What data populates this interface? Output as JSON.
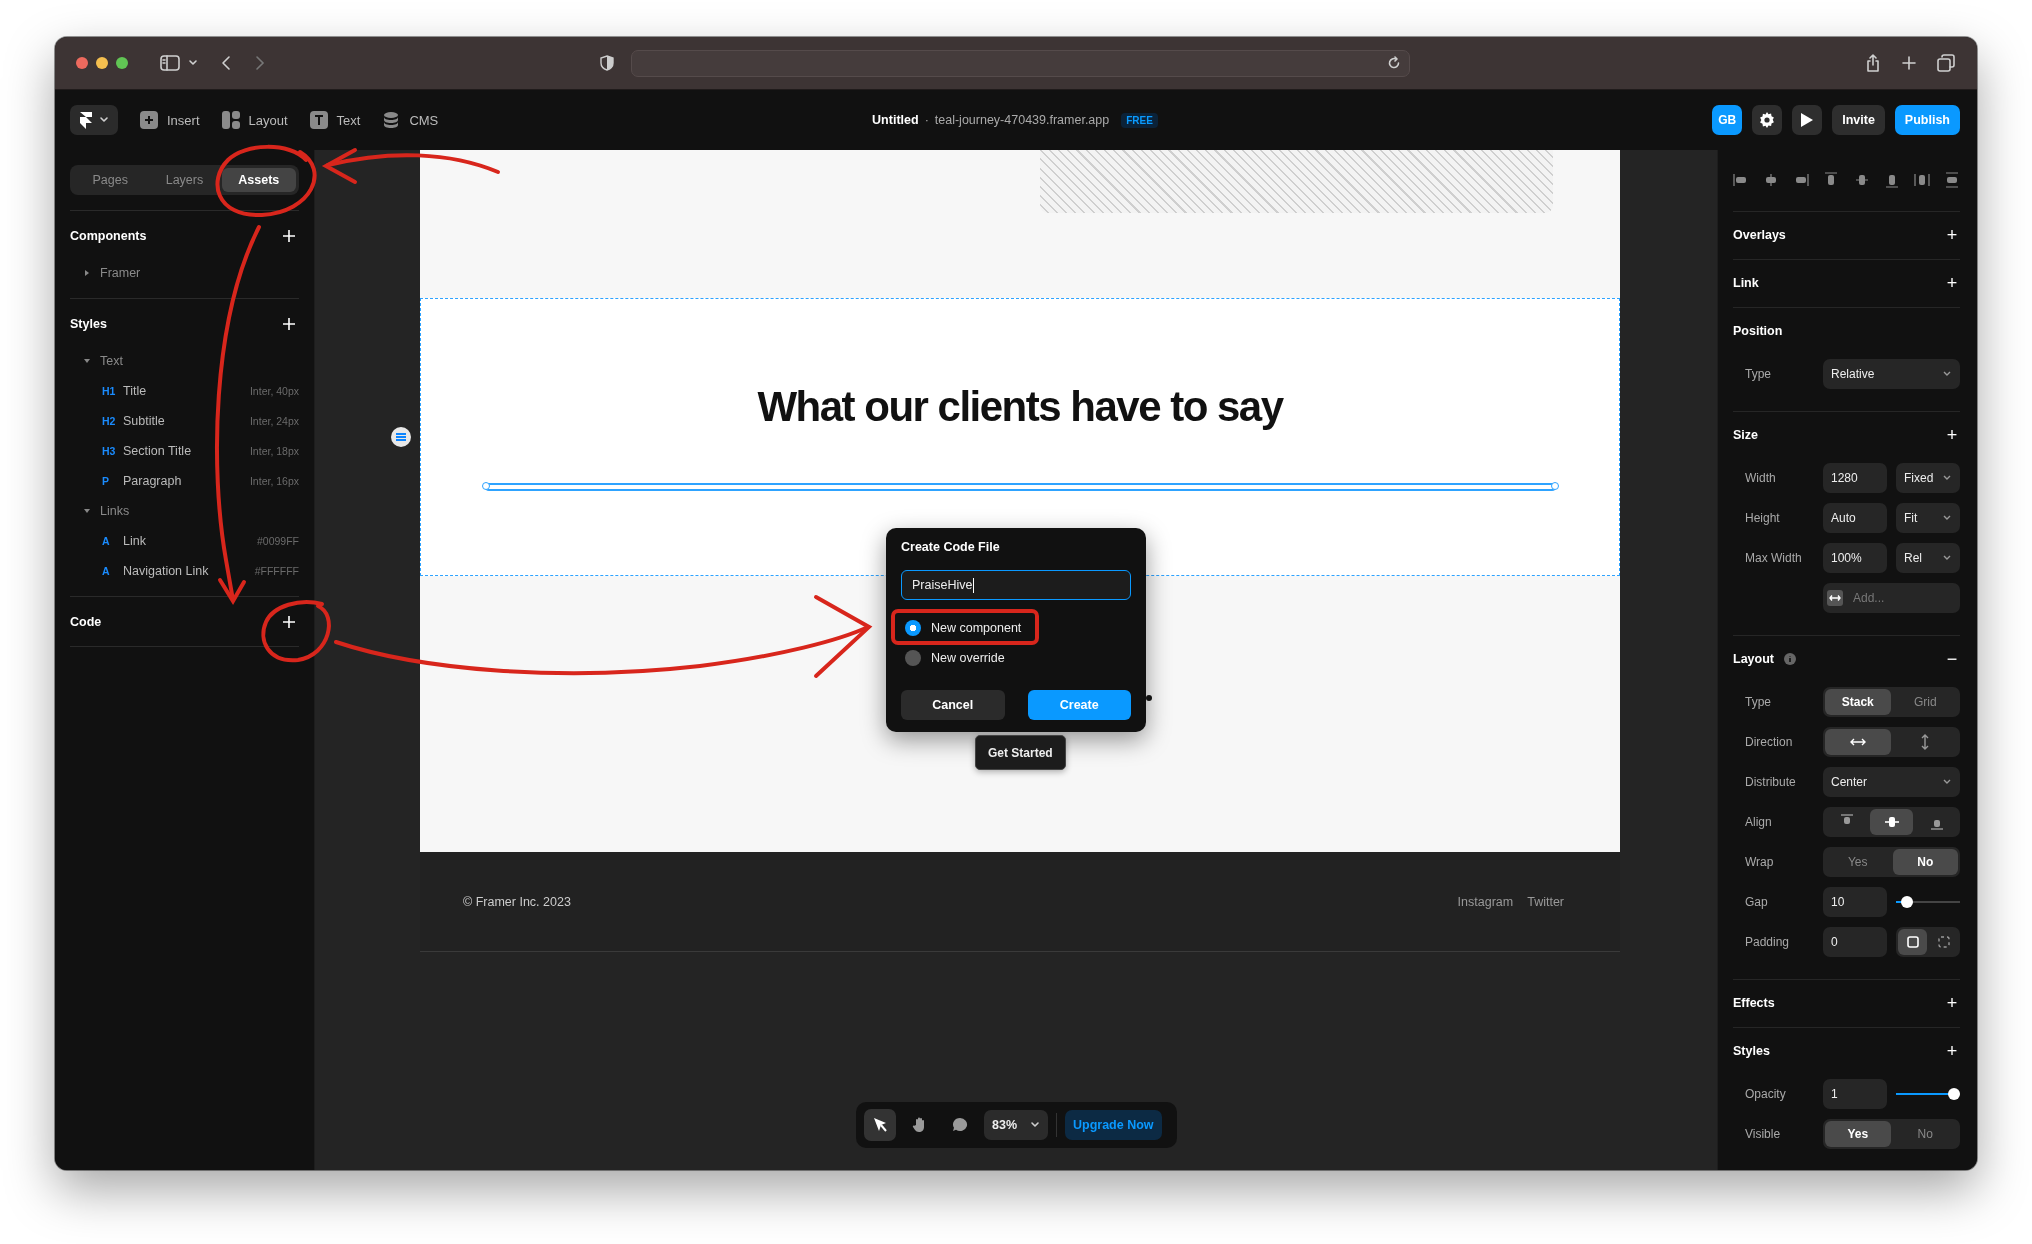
{
  "toolbar": {
    "menu": [
      {
        "kind": "insert",
        "label": "Insert"
      },
      {
        "kind": "layout",
        "label": "Layout"
      },
      {
        "kind": "text",
        "label": "Text"
      },
      {
        "kind": "cms",
        "label": "CMS"
      }
    ],
    "title": "Untitled",
    "separator": "·",
    "url": "teal-journey-470439.framer.app",
    "plan": "FREE",
    "avatar": "GB",
    "invite": "Invite",
    "publish": "Publish"
  },
  "left_panel": {
    "tabs": [
      {
        "label": "Pages",
        "selected": false
      },
      {
        "label": "Layers",
        "selected": false
      },
      {
        "label": "Assets",
        "selected": true
      }
    ],
    "sections": [
      {
        "title": "Components",
        "items": [
          {
            "label": "Framer",
            "expanded": false
          }
        ]
      },
      {
        "title": "Styles",
        "items": [
          {
            "label": "Text",
            "expanded": true,
            "children": [
              {
                "tag": "H1",
                "label": "Title",
                "detail": "Inter, 40px"
              },
              {
                "tag": "H2",
                "label": "Subtitle",
                "detail": "Inter, 24px"
              },
              {
                "tag": "H3",
                "label": "Section Title",
                "detail": "Inter, 18px"
              },
              {
                "tag": "P",
                "label": "Paragraph",
                "detail": "Inter, 16px"
              }
            ]
          },
          {
            "label": "Links",
            "expanded": true,
            "children": [
              {
                "tag": "A",
                "label": "Link",
                "detail": "#0099FF"
              },
              {
                "tag": "A",
                "label": "Navigation Link",
                "detail": "#FFFFFF"
              }
            ]
          }
        ]
      },
      {
        "title": "Code"
      }
    ]
  },
  "canvas": {
    "heading": "What our clients have to say",
    "footer": {
      "copyright": "© Framer Inc. 2023",
      "links": [
        "Instagram",
        "Twitter"
      ]
    },
    "dialog": {
      "title": "Create Code File",
      "value": "PraiseHive",
      "options": [
        {
          "label": "New component",
          "selected": true
        },
        {
          "label": "New override",
          "selected": false
        }
      ],
      "cancel": "Cancel",
      "create": "Create"
    },
    "tooltip": "Get Started",
    "tools": [
      {
        "kind": "select",
        "selected": true
      },
      {
        "kind": "hand",
        "selected": false
      },
      {
        "kind": "comment",
        "selected": false
      }
    ],
    "zoom": "83%",
    "upgrade": "Upgrade Now"
  },
  "right_panel": {
    "sections": [
      {
        "title": "Overlays",
        "action": "+"
      },
      {
        "title": "Link",
        "action": "+"
      },
      {
        "title": "Position",
        "rows": [
          {
            "kind": "select",
            "label": "Type",
            "value": "Relative"
          }
        ]
      },
      {
        "title": "Size",
        "action": "+",
        "rows": [
          {
            "kind": "input_select",
            "label": "Width",
            "value": "1280",
            "unit": "Fixed"
          },
          {
            "kind": "input_select",
            "label": "Height",
            "value": "Auto",
            "unit": "Fit"
          },
          {
            "kind": "input_select",
            "label": "Max Width",
            "value": "100%",
            "unit": "Rel"
          },
          {
            "kind": "add",
            "placeholder": "Add..."
          }
        ]
      },
      {
        "title": "Layout",
        "info": true,
        "action": "−",
        "rows": [
          {
            "kind": "segmented",
            "label": "Type",
            "options": [
              {
                "label": "Stack",
                "selected": true
              },
              {
                "label": "Grid",
                "selected": false
              }
            ]
          },
          {
            "kind": "direction",
            "label": "Direction",
            "options": [
              {
                "selected": true
              },
              {
                "selected": false
              }
            ]
          },
          {
            "kind": "select",
            "label": "Distribute",
            "value": "Center"
          },
          {
            "kind": "align",
            "label": "Align",
            "options": [
              {
                "selected": false
              },
              {
                "selected": true
              },
              {
                "selected": false
              }
            ]
          },
          {
            "kind": "segmented",
            "label": "Wrap",
            "options": [
              {
                "label": "Yes",
                "selected": false
              },
              {
                "label": "No",
                "selected": true
              }
            ]
          },
          {
            "kind": "slider",
            "label": "Gap",
            "value": "10",
            "level": 0.1
          },
          {
            "kind": "padding",
            "label": "Padding",
            "value": "0",
            "options": [
              {
                "selected": true
              },
              {
                "selected": false
              }
            ]
          }
        ]
      },
      {
        "title": "Effects",
        "action": "+"
      },
      {
        "title": "Styles",
        "action": "+",
        "rows": [
          {
            "kind": "slider",
            "label": "Opacity",
            "value": "1",
            "level": 1
          },
          {
            "kind": "segmented",
            "label": "Visible",
            "options": [
              {
                "label": "Yes",
                "selected": true
              },
              {
                "label": "No",
                "selected": false
              }
            ]
          }
        ]
      }
    ]
  }
}
